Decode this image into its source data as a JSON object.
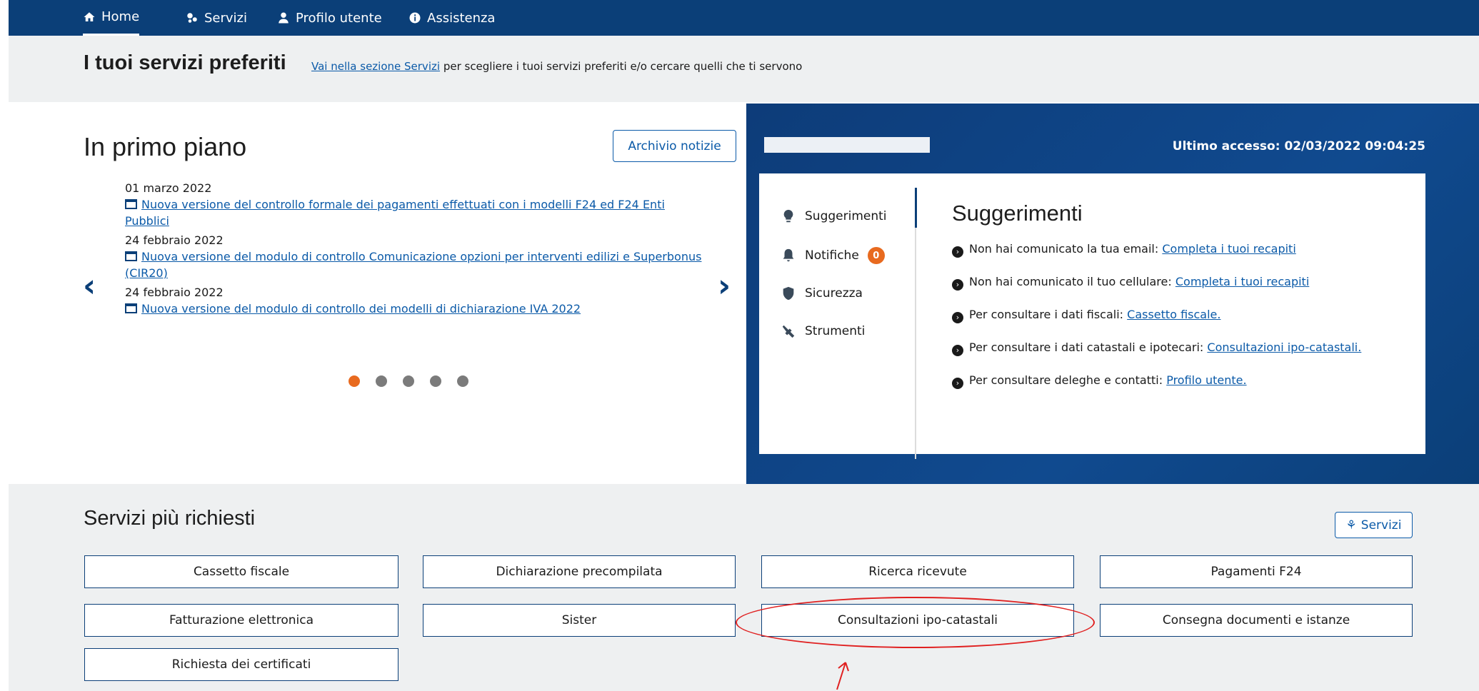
{
  "topnav": {
    "items": [
      {
        "label": "Home",
        "icon": "home-icon"
      },
      {
        "label": "Servizi",
        "icon": "services-icon"
      },
      {
        "label": "Profilo utente",
        "icon": "user-icon"
      },
      {
        "label": "Assistenza",
        "icon": "info-icon"
      }
    ],
    "active": "Home"
  },
  "favourites": {
    "title": "I tuoi servizi preferiti",
    "link": "Vai nella sezione Servizi",
    "text": "per scegliere i tuoi servizi preferiti e/o cercare quelli che ti servono"
  },
  "news": {
    "title": "In primo piano",
    "archive_button": "Archivio notizie",
    "items": [
      {
        "date": "01 marzo 2022",
        "title": "Nuova versione del controllo formale dei pagamenti effettuati con i modelli F24 ed F24 Enti Pubblici"
      },
      {
        "date": "24 febbraio 2022",
        "title": "Nuova versione del modulo di controllo Comunicazione opzioni per interventi edilizi e Superbonus (CIR20)"
      },
      {
        "date": "24 febbraio 2022",
        "title": "Nuova versione del modulo di controllo dei modelli di dichiarazione IVA 2022"
      }
    ],
    "prev_arrow": "‹",
    "next_arrow": "›",
    "dots": 5,
    "active_dot": 0
  },
  "user_panel": {
    "last_access": "Ultimo accesso: 02/03/2022 09:04:25",
    "tabs": [
      {
        "label": "Suggerimenti",
        "icon": "lightbulb-icon"
      },
      {
        "label": "Notifiche",
        "icon": "bell-icon",
        "badge": "0"
      },
      {
        "label": "Sicurezza",
        "icon": "shield-icon"
      },
      {
        "label": "Strumenti",
        "icon": "tools-icon"
      }
    ],
    "active_tab": "Suggerimenti",
    "suggestions_title": "Suggerimenti",
    "suggestions": [
      {
        "text": "Non hai comunicato la tua email:",
        "link": "Completa i tuoi recapiti"
      },
      {
        "text": "Non hai comunicato il tuo cellulare:",
        "link": "Completa i tuoi recapiti"
      },
      {
        "text": "Per consultare i dati fiscali:",
        "link": "Cassetto fiscale."
      },
      {
        "text": "Per consultare i dati catastali e ipotecari:",
        "link": "Consultazioni ipo-catastali."
      },
      {
        "text": "Per consultare deleghe e contatti:",
        "link": "Profilo utente."
      }
    ]
  },
  "services": {
    "title": "Servizi più richiesti",
    "button": "Servizi",
    "items": [
      "Cassetto fiscale",
      "Dichiarazione precompilata",
      "Ricerca ricevute",
      "Pagamenti F24",
      "Fatturazione elettronica",
      "Sister",
      "Consultazioni ipo-catastali",
      "Consegna documenti e istanze",
      "Richiesta dei certificati"
    ],
    "highlighted": "Consultazioni ipo-catastali",
    "highlight_color": "#e02020"
  },
  "colors": {
    "brand": "#0b3f78",
    "link": "#0b5aa8",
    "accent": "#e86a1f"
  }
}
